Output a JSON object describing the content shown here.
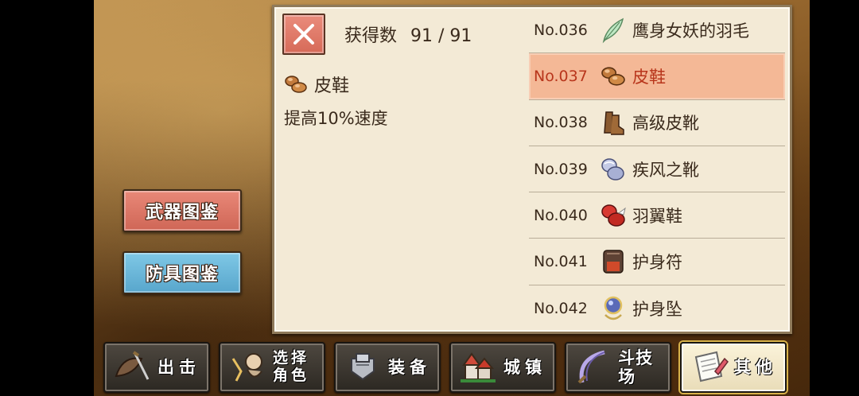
{
  "categories": {
    "weapon_label": "武器图鉴",
    "armor_label": "防具图鉴"
  },
  "panel": {
    "count_label": "获得数",
    "count_value": "91 / 91",
    "detail": {
      "name": "皮鞋",
      "description": "提高10%速度",
      "icon": "leather-shoes-icon"
    },
    "items": [
      {
        "no": "No.036",
        "name": "鹰身女妖的羽毛",
        "icon": "harpy-feather-icon",
        "color": "#9fd8a8"
      },
      {
        "no": "No.037",
        "name": "皮鞋",
        "icon": "leather-shoes-icon",
        "color": "#c07a3a",
        "selected": true
      },
      {
        "no": "No.038",
        "name": "高级皮靴",
        "icon": "advanced-boots-icon",
        "color": "#8a5a30"
      },
      {
        "no": "No.039",
        "name": "疾风之靴",
        "icon": "gale-boots-icon",
        "color": "#a0a8c8"
      },
      {
        "no": "No.040",
        "name": "羽翼鞋",
        "icon": "winged-shoes-icon",
        "color": "#d03030"
      },
      {
        "no": "No.041",
        "name": "护身符",
        "icon": "amulet-icon",
        "color": "#6a4a3a"
      },
      {
        "no": "No.042",
        "name": "护身坠",
        "icon": "pendant-icon",
        "color": "#4a5aa0"
      }
    ]
  },
  "menu": [
    {
      "label": "出击",
      "icon": "sortie-icon"
    },
    {
      "label": "选择\n角色",
      "icon": "character-select-icon"
    },
    {
      "label": "装备",
      "icon": "equipment-icon"
    },
    {
      "label": "城镇",
      "icon": "town-icon"
    },
    {
      "label": "斗技场",
      "icon": "arena-icon"
    },
    {
      "label": "其他",
      "icon": "other-icon",
      "active": true
    }
  ],
  "colors": {
    "selected_row_bg": "#f4b896",
    "selected_text": "#b8361c",
    "weapon_btn": "#e07a6a",
    "armor_btn": "#6ab8dc"
  }
}
